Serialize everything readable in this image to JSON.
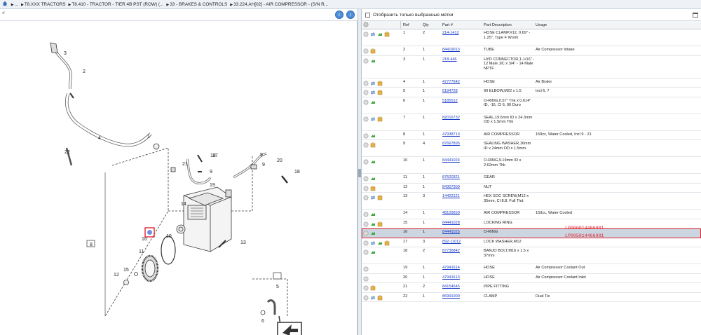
{
  "breadcrumb": {
    "items": [
      "...",
      "T8.XXX TRACTORS",
      "T8.410 - TRACTOR - TIER 4B PST (ROW) (...",
      "33 - BRAKES & CONTROLS",
      "33.224.AH[02] - AIR COMPRESSOR - (S/N R..."
    ]
  },
  "filter": {
    "label": "Отобразить только выбранные метки"
  },
  "table": {
    "headers": {
      "ref": "Ref",
      "qty": "Qty",
      "part": "Part #",
      "desc": "Part Description",
      "usage": "Usage"
    },
    "rows": [
      {
        "ref": "1",
        "qty": "2",
        "part": "214-1412",
        "desc": "HOSE CLAMP,#12, 0.69\" - 1.25\", Type F Worm",
        "usage": "",
        "icons": [
          "circle",
          "swap",
          "green",
          "box"
        ],
        "h": 2
      },
      {
        "ref": "2",
        "qty": "1",
        "part": "84419013",
        "desc": "TUBE",
        "usage": "Air Compressor Intake",
        "icons": [
          "circle",
          "box"
        ],
        "h": 1
      },
      {
        "ref": "3",
        "qty": "1",
        "part": "218-446",
        "desc": "HYD CONNECTOR,1-1/16\" - 12 Male JIC x 3/4\" - 14 Male NPTF",
        "usage": "",
        "icons": [
          "circle",
          "green"
        ],
        "h": 3
      },
      {
        "ref": "4",
        "qty": "1",
        "part": "47777642",
        "desc": "HOSE",
        "usage": "Air Brake",
        "icons": [
          "circle",
          "swap",
          "box"
        ],
        "h": 1
      },
      {
        "ref": "5",
        "qty": "1",
        "part": "5194728",
        "desc": "90 ELBOW,M22 x 1.5",
        "usage": "Incl 6, 7",
        "icons": [
          "circle",
          "swap",
          "box"
        ],
        "h": 1
      },
      {
        "ref": "6",
        "qty": "1",
        "part": "5185512",
        "desc": "O-RING,0.57\" Thk x 0.614\" ID, -16, Cl 6, 90 Duro",
        "usage": "",
        "icons": [
          "circle",
          "green"
        ],
        "h": 2
      },
      {
        "ref": "7",
        "qty": "1",
        "part": "82016732",
        "desc": "SEAL,19.6mm ID x 24.3mm OD x 1.5mm Thk",
        "usage": "",
        "icons": [
          "circle",
          "swap",
          "box"
        ],
        "h": 2
      },
      {
        "ref": "8",
        "qty": "1",
        "part": "47938713",
        "desc": "AIR COMPRESSOR",
        "usage": "159cc, Water Cooled, Incl 9 - 21",
        "icons": [
          "circle",
          "green"
        ],
        "h": 1
      },
      {
        "ref": "9",
        "qty": "4",
        "part": "87667895",
        "desc": "SEALING WASHER,16mm ID x 24mm OD x 1.5mm",
        "usage": "",
        "icons": [
          "circle",
          "box"
        ],
        "h": 2
      },
      {
        "ref": "10",
        "qty": "1",
        "part": "84441024",
        "desc": "O-RING,9.19mm ID x 2.62mm Thk",
        "usage": "",
        "icons": [
          "circle",
          "green"
        ],
        "h": 2
      },
      {
        "ref": "11",
        "qty": "1",
        "part": "87520321",
        "desc": "GEAR",
        "usage": "",
        "icons": [
          "circle",
          "green"
        ],
        "h": 1
      },
      {
        "ref": "12",
        "qty": "1",
        "part": "84307309",
        "desc": "NUT",
        "usage": "",
        "icons": [
          "circle",
          "box"
        ],
        "h": 1
      },
      {
        "ref": "13",
        "qty": "3",
        "part": "14422121",
        "desc": "HEX SOC SCREW,M12 x 35mm, Cl 8.8, Full Thd",
        "usage": "",
        "icons": [
          "circle",
          "swap",
          "box"
        ],
        "h": 2
      },
      {
        "ref": "14",
        "qty": "1",
        "part": "48129650",
        "desc": "AIR COMPRESSOR",
        "usage": "159cc, Water Cooled",
        "icons": [
          "circle",
          "green"
        ],
        "h": 1
      },
      {
        "ref": "15",
        "qty": "1",
        "part": "84441028",
        "desc": "LOCKING RING",
        "usage": "",
        "icons": [
          "circle",
          "green",
          "box"
        ],
        "h": 1
      },
      {
        "ref": "16",
        "qty": "1",
        "part": "84441025",
        "desc": "O-RING",
        "usage": "",
        "icons": [
          "circle",
          "green"
        ],
        "h": 1,
        "selected": true
      },
      {
        "ref": "17",
        "qty": "3",
        "part": "892-11012",
        "desc": "LOCK WASHER,M12",
        "usage": "",
        "icons": [
          "circle",
          "swap",
          "green",
          "box"
        ],
        "h": 1
      },
      {
        "ref": "18",
        "qty": "2",
        "part": "87736842",
        "desc": "BANJO BOLT,M16 x 1.5 x 37mm",
        "usage": "",
        "icons": [
          "circle",
          "green"
        ],
        "h": 2
      },
      {
        "ref": "19",
        "qty": "1",
        "part": "47941614",
        "desc": "HOSE",
        "usage": "Air Compressor Coolant Out",
        "icons": [
          "circle"
        ],
        "h": 1
      },
      {
        "ref": "20",
        "qty": "1",
        "part": "47941613",
        "desc": "HOSE",
        "usage": "Air Compressor Coolant Inlet",
        "icons": [
          "circle"
        ],
        "h": 1
      },
      {
        "ref": "21",
        "qty": "2",
        "part": "84154645",
        "desc": "PIPE FITTING",
        "usage": "",
        "icons": [
          "circle",
          "box"
        ],
        "h": 1
      },
      {
        "ref": "22",
        "qty": "1",
        "part": "86991000",
        "desc": "CLAMP",
        "usage": "Dual Tie",
        "icons": [
          "circle",
          "swap",
          "box"
        ],
        "h": 1
      }
    ]
  },
  "overlay_ids": [
    "LP000014466981",
    "LP005014466981"
  ],
  "diagram_labels": [
    "1",
    "2",
    "3",
    "4",
    "5",
    "6",
    "7",
    "8",
    "9",
    "9",
    "9",
    "10",
    "11",
    "12",
    "13",
    "14",
    "15",
    "16",
    "17",
    "18",
    "18",
    "19",
    "20",
    "21",
    "22"
  ],
  "colors": {
    "link": "#1a3cc8",
    "highlight": "#e0242e",
    "selected_row": "#cbd6e1",
    "nav_button": "#4f8fd8"
  }
}
